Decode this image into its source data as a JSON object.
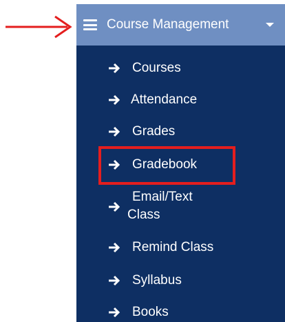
{
  "menu": {
    "header_title": "Course Management",
    "header_icon": "hamburger-icon",
    "caret_icon": "caret-down-icon",
    "items": [
      {
        "label": "Courses",
        "icon": "arrow-right-icon"
      },
      {
        "label": "Attendance",
        "icon": "arrow-right-icon"
      },
      {
        "label": "Grades",
        "icon": "arrow-right-icon"
      },
      {
        "label": "Gradebook",
        "icon": "arrow-right-icon",
        "highlighted": true
      },
      {
        "label_line1": "Email/Text",
        "label_line2": "Class",
        "icon": "arrow-right-icon"
      },
      {
        "label": "Remind Class",
        "icon": "arrow-right-icon"
      },
      {
        "label": "Syllabus",
        "icon": "arrow-right-icon"
      },
      {
        "label": "Books",
        "icon": "arrow-right-icon"
      }
    ]
  },
  "annotations": {
    "pointer_arrow_color": "#e41e1e",
    "highlight_color": "#e41e1e"
  },
  "colors": {
    "panel_background": "#0e2f63",
    "header_background": "#6f8fc2",
    "text": "#ffffff"
  }
}
